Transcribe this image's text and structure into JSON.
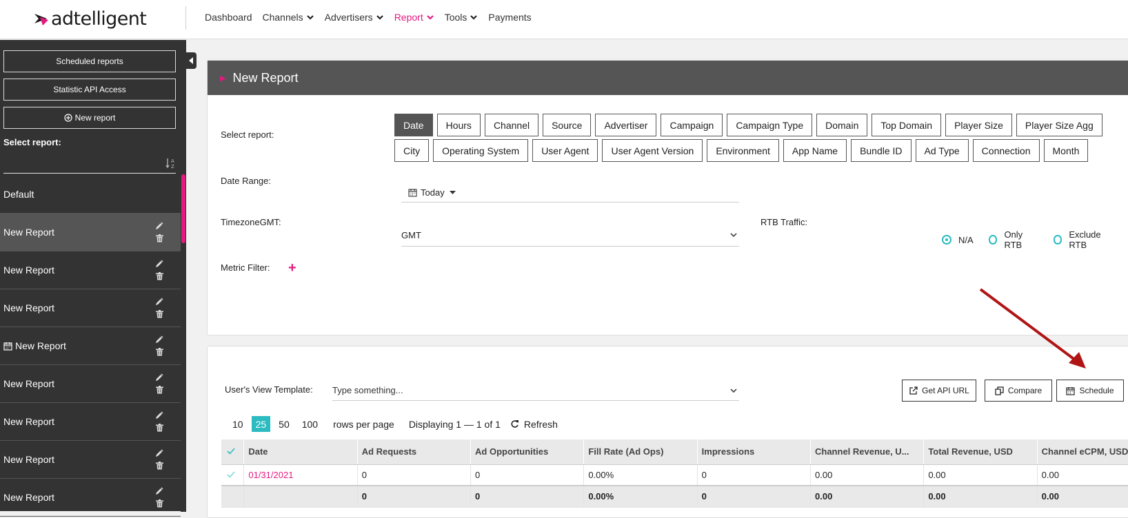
{
  "brand": {
    "logo_text": "adtelligent",
    "accent": "#e5197f",
    "teal": "#2bbbc0"
  },
  "nav": [
    {
      "label": "Dashboard",
      "dropdown": false,
      "active": false
    },
    {
      "label": "Channels",
      "dropdown": true,
      "active": false
    },
    {
      "label": "Advertisers",
      "dropdown": true,
      "active": false
    },
    {
      "label": "Report",
      "dropdown": true,
      "active": true
    },
    {
      "label": "Tools",
      "dropdown": true,
      "active": false
    },
    {
      "label": "Payments",
      "dropdown": false,
      "active": false
    }
  ],
  "sidebar": {
    "scheduled_label": "Scheduled reports",
    "api_label": "Statistic API Access",
    "new_report_label": "New report",
    "select_label": "Select report:",
    "reports": [
      {
        "label": "Default",
        "editable": false,
        "scheduled": false,
        "selected": false
      },
      {
        "label": "New Report",
        "editable": true,
        "scheduled": false,
        "selected": true
      },
      {
        "label": "New Report",
        "editable": true,
        "scheduled": false,
        "selected": false
      },
      {
        "label": "New Report",
        "editable": true,
        "scheduled": false,
        "selected": false
      },
      {
        "label": "New Report",
        "editable": true,
        "scheduled": true,
        "selected": false
      },
      {
        "label": "New Report",
        "editable": true,
        "scheduled": false,
        "selected": false
      },
      {
        "label": "New Report",
        "editable": true,
        "scheduled": false,
        "selected": false
      },
      {
        "label": "New Report",
        "editable": true,
        "scheduled": false,
        "selected": false
      },
      {
        "label": "New Report",
        "editable": true,
        "scheduled": false,
        "selected": false
      }
    ]
  },
  "report": {
    "title": "New Report",
    "select_label": "Select report:",
    "dimensions_row1": [
      "Date",
      "Hours",
      "Channel",
      "Source",
      "Advertiser",
      "Campaign",
      "Campaign Type",
      "Domain",
      "Top Domain",
      "Player Size",
      "Player Size Agg"
    ],
    "dimensions_row2": [
      "City",
      "Operating System",
      "User Agent",
      "User Agent Version",
      "Environment",
      "App Name",
      "Bundle ID",
      "Ad Type",
      "Connection",
      "Month"
    ],
    "active_dimension": "Date",
    "date_range_label": "Date Range:",
    "date_range_value": "Today",
    "timezone_label": "TimezoneGMT:",
    "timezone_value": "GMT",
    "rtb_label": "RTB Traffic:",
    "rtb_options": [
      "N/A",
      "Only RTB",
      "Exclude RTB"
    ],
    "rtb_selected": "N/A",
    "metric_filter_label": "Metric Filter:"
  },
  "results": {
    "template_label": "User's View Template:",
    "template_placeholder": "Type something...",
    "get_api_label": "Get API URL",
    "compare_label": "Compare",
    "schedule_label": "Schedule",
    "page_sizes": [
      "10",
      "25",
      "50",
      "100"
    ],
    "active_page_size": "25",
    "rows_per_page_label": "rows per page",
    "displaying": "Displaying 1 — 1 of 1",
    "refresh_label": "Refresh",
    "columns": [
      "Date",
      "Ad Requests",
      "Ad Opportunities",
      "Fill Rate (Ad Ops)",
      "Impressions",
      "Channel Revenue, U...",
      "Total Revenue, USD",
      "Channel eCPM, USD"
    ],
    "rows": [
      [
        "01/31/2021",
        "0",
        "0",
        "0.00%",
        "0",
        "0.00",
        "0.00",
        "0.00"
      ]
    ],
    "totals": [
      "",
      "0",
      "0",
      "0.00%",
      "0",
      "0.00",
      "0.00",
      "0.00"
    ]
  }
}
